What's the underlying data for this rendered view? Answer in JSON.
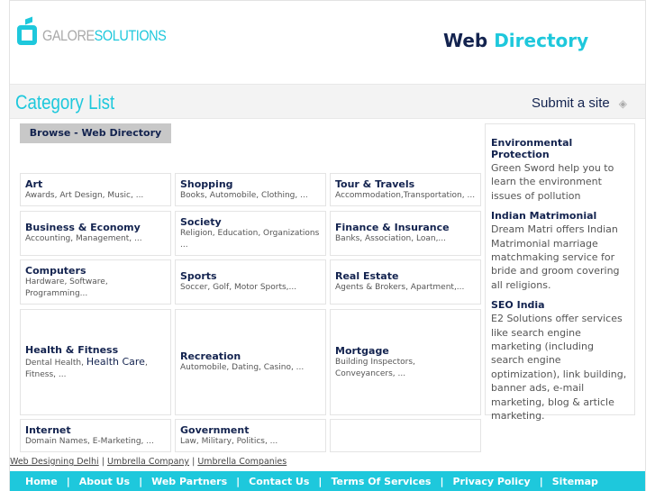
{
  "header": {
    "logo_a": "GALORE",
    "logo_b": "SOLUTIONS",
    "title_a": "Web",
    "title_b": "Directory"
  },
  "catbar": {
    "title": "Category List",
    "submit": "Submit a site"
  },
  "browse": "Browse - Web Directory",
  "categories": [
    {
      "name": "Art",
      "desc": "Awards, Art Design, Music, ..."
    },
    {
      "name": "Shopping",
      "desc": "Books, Automobile, Clothing, ..."
    },
    {
      "name": "Tour & Travels",
      "desc": "Accommodation,Transportation, ..."
    },
    {
      "name": "Business & Economy",
      "desc": "Accounting, Management, ..."
    },
    {
      "name": "Society",
      "desc": "Religion, Education, Organizations ..."
    },
    {
      "name": "Finance & Insurance",
      "desc": "Banks, Association, Loan,..."
    },
    {
      "name": "Computers",
      "desc": "Hardware, Software, Programming..."
    },
    {
      "name": "Sports",
      "desc": "Soccer, Golf, Motor Sports,..."
    },
    {
      "name": "Real Estate",
      "desc": "Agents & Brokers, Apartment,..."
    },
    {
      "name": "Health & Fitness",
      "desc_a": "Dental Health, ",
      "desc_hl": "Health Care",
      "desc_b": ", Fitness, ..."
    },
    {
      "name": "Recreation",
      "desc": "Automobile, Dating, Casino, ..."
    },
    {
      "name": "Mortgage",
      "desc": "Building Inspectors, Conveyancers, ..."
    },
    {
      "name": "Internet",
      "desc": "Domain Names, E-Marketing, ..."
    },
    {
      "name": "Government",
      "desc": "Law, Military, Politics, ..."
    }
  ],
  "sidebar": [
    {
      "title": "Environmental Protection",
      "text": "Green Sword help you to learn the environment issues of pollution"
    },
    {
      "title": "Indian Matrimonial",
      "text": "Dream Matri offers Indian Matrimonial marriage matchmaking service for bride and groom covering all religions."
    },
    {
      "title": "SEO India",
      "text": "E2 Solutions offer services like search engine marketing (including search engine optimization), link building, banner ads, e-mail marketing, blog & article marketing."
    }
  ],
  "links": [
    "Web Designing Delhi",
    "Umbrella Company",
    "Umbrella Companies"
  ],
  "nav": [
    "Home",
    "About Us",
    "Web Partners",
    "Contact Us",
    "Terms Of Services",
    "Privacy Policy",
    "Sitemap"
  ]
}
